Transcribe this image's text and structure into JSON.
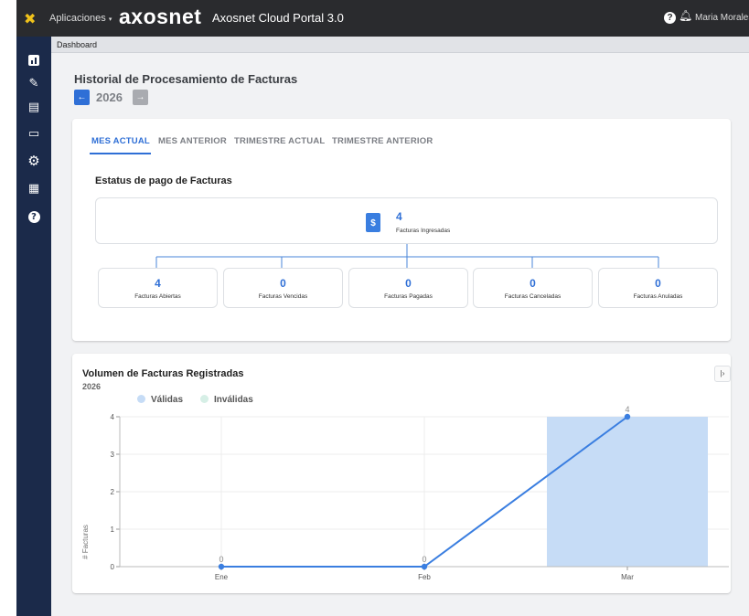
{
  "topbar": {
    "apps_label": "Aplicaciones",
    "logo_text": "axosnet",
    "portal_title": "Axosnet Cloud Portal 3.0",
    "user_name": "Maria Morales"
  },
  "breadcrumb": "Dashboard",
  "page_title": "Historial de Procesamiento de Facturas",
  "year": "2026",
  "tabs": [
    "MES ACTUAL",
    "MES ANTERIOR",
    "TRIMESTRE ACTUAL",
    "TRIMESTRE ANTERIOR"
  ],
  "status": {
    "title": "Estatus de pago de Facturas",
    "total": {
      "value": "4",
      "label": "Facturas Ingresadas"
    },
    "items": [
      {
        "value": "4",
        "label": "Facturas Abiertas"
      },
      {
        "value": "0",
        "label": "Facturas Vencidas"
      },
      {
        "value": "0",
        "label": "Facturas Pagadas"
      },
      {
        "value": "0",
        "label": "Facturas Canceladas"
      },
      {
        "value": "0",
        "label": "Facturas Anuladas"
      }
    ]
  },
  "volume": {
    "title": "Volumen de Facturas Registradas",
    "subtitle": "2026"
  },
  "chart_data": {
    "type": "bar",
    "categories": [
      "Ene",
      "Feb",
      "Mar"
    ],
    "series": [
      {
        "name": "Válidas",
        "type": "line",
        "values": [
          0,
          0,
          4
        ],
        "color": "#3a7ee0"
      },
      {
        "name": "Inválidas",
        "type": "bar",
        "values": [
          0,
          0,
          4
        ],
        "color": "#c6dcf6"
      }
    ],
    "data_labels": [
      "0",
      "0",
      "4"
    ],
    "ylabel": "# Facturas",
    "yticks": [
      0,
      1,
      2,
      3,
      4
    ],
    "ylim": [
      0,
      4
    ],
    "grid": true,
    "legend": "top-left"
  },
  "colors": {
    "accent": "#2f6fd6",
    "sidebar": "#1b2a4a",
    "topbar": "#2a2b2e"
  }
}
